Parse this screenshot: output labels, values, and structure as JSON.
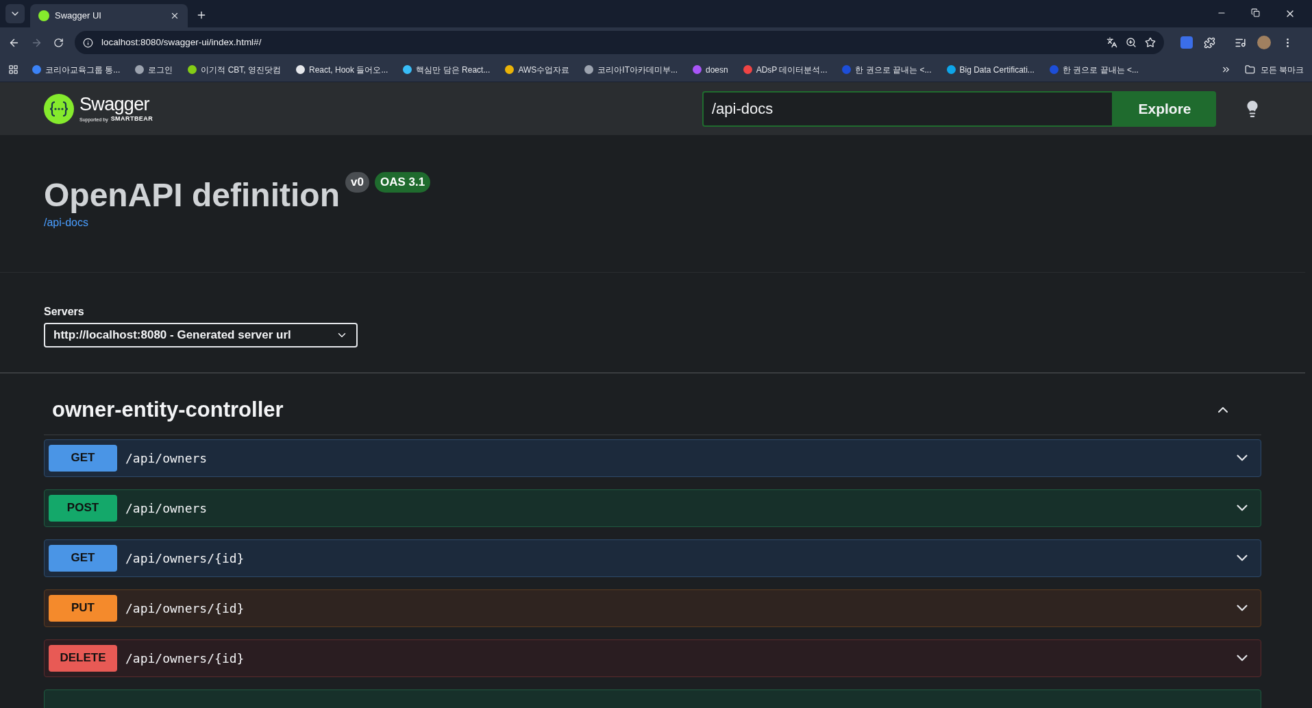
{
  "browser": {
    "tab": {
      "title": "Swagger UI",
      "selected": true
    },
    "address": "localhost:8080/swagger-ui/index.html#/",
    "bookmarks": [
      {
        "label": "코리아교육그룹 통..."
      },
      {
        "label": "로그인"
      },
      {
        "label": "이기적 CBT, 영진닷컴"
      },
      {
        "label": "React, Hook 들어오..."
      },
      {
        "label": "핵심만 담은 React..."
      },
      {
        "label": "AWS수업자료"
      },
      {
        "label": "코리아IT아카데미부..."
      },
      {
        "label": "doesn"
      },
      {
        "label": "ADsP 데이터분석..."
      },
      {
        "label": "한 권으로 끝내는 <..."
      },
      {
        "label": "Big Data Certificati..."
      },
      {
        "label": "한 권으로 끝내는 <..."
      }
    ],
    "all_bookmarks": "모든 북마크"
  },
  "topbar": {
    "logo_text": "Swagger",
    "logo_sub": "Supported by",
    "logo_brand": "SMARTBEAR",
    "url_value": "/api-docs",
    "explore": "Explore"
  },
  "info": {
    "title": "OpenAPI definition",
    "version": "v0",
    "oas": "OAS 3.1",
    "link": "/api-docs"
  },
  "servers": {
    "label": "Servers",
    "selected": "http://localhost:8080 - Generated server url"
  },
  "section": {
    "name": "owner-entity-controller",
    "expanded": true,
    "operations": [
      {
        "kind": "get",
        "method": "GET",
        "path": "/api/owners"
      },
      {
        "kind": "post",
        "method": "POST",
        "path": "/api/owners"
      },
      {
        "kind": "get",
        "method": "GET",
        "path": "/api/owners/{id}"
      },
      {
        "kind": "put",
        "method": "PUT",
        "path": "/api/owners/{id}"
      },
      {
        "kind": "delete",
        "method": "DELETE",
        "path": "/api/owners/{id}"
      }
    ]
  }
}
